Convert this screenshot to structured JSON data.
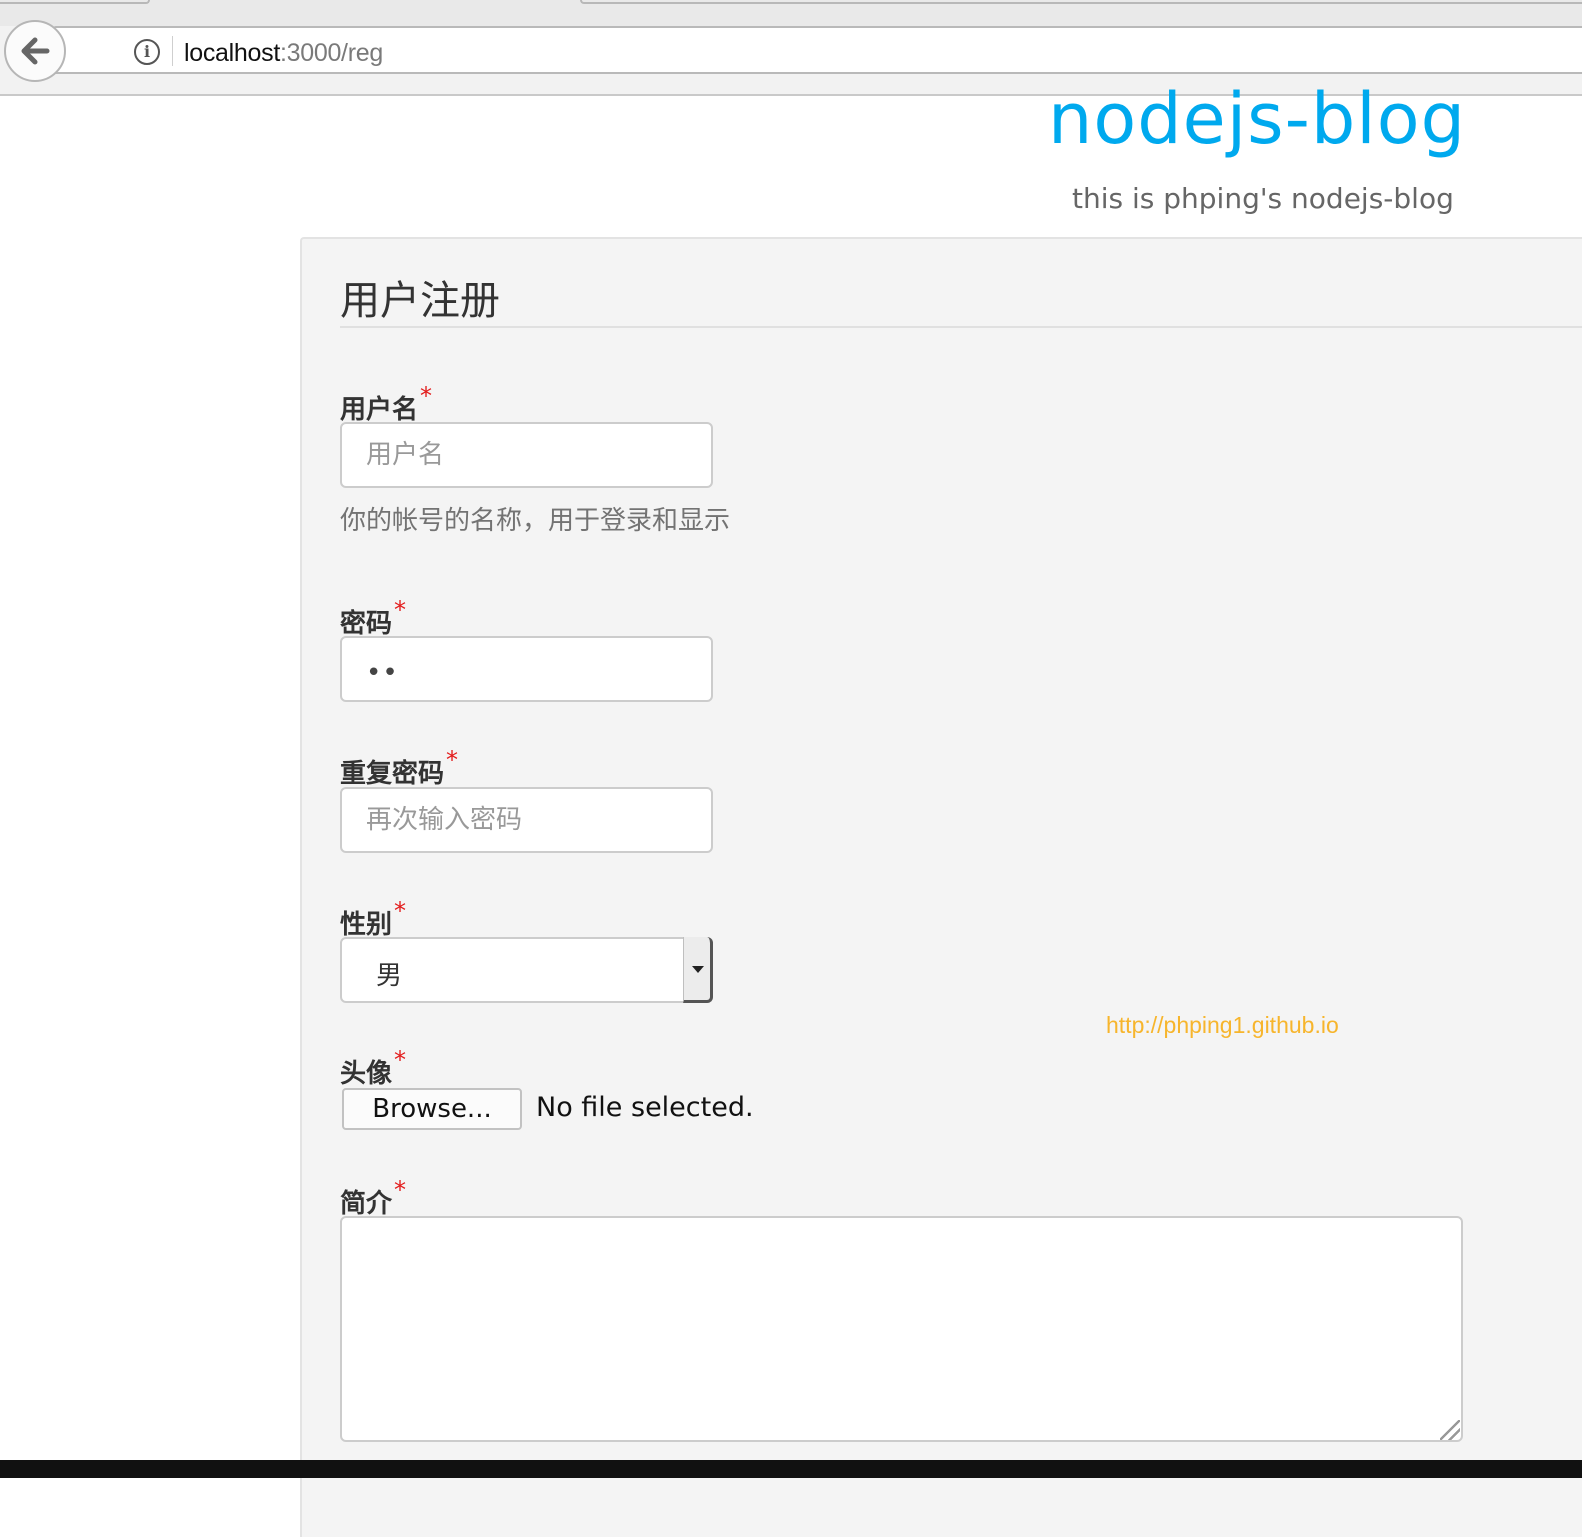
{
  "browser": {
    "url_host": "localhost",
    "url_path": ":3000/reg"
  },
  "header": {
    "title": "nodejs-blog",
    "subtitle": "this is phping's nodejs-blog"
  },
  "form": {
    "legend": "用户注册",
    "required_mark": "*",
    "username": {
      "label": "用户名",
      "placeholder": "用户名",
      "help": "你的帐号的名称，用于登录和显示"
    },
    "password": {
      "label": "密码",
      "masked_value": "••"
    },
    "repeat_password": {
      "label": "重复密码",
      "placeholder": "再次输入密码"
    },
    "gender": {
      "label": "性别",
      "selected": "男"
    },
    "avatar": {
      "label": "头像",
      "browse_label": "Browse...",
      "status": "No file selected."
    },
    "bio": {
      "label": "简介"
    }
  },
  "watermark": "http://phping1.github.io",
  "colors": {
    "title": "#00a9ee",
    "required": "#e31b1b",
    "watermark": "#f7b52c"
  }
}
